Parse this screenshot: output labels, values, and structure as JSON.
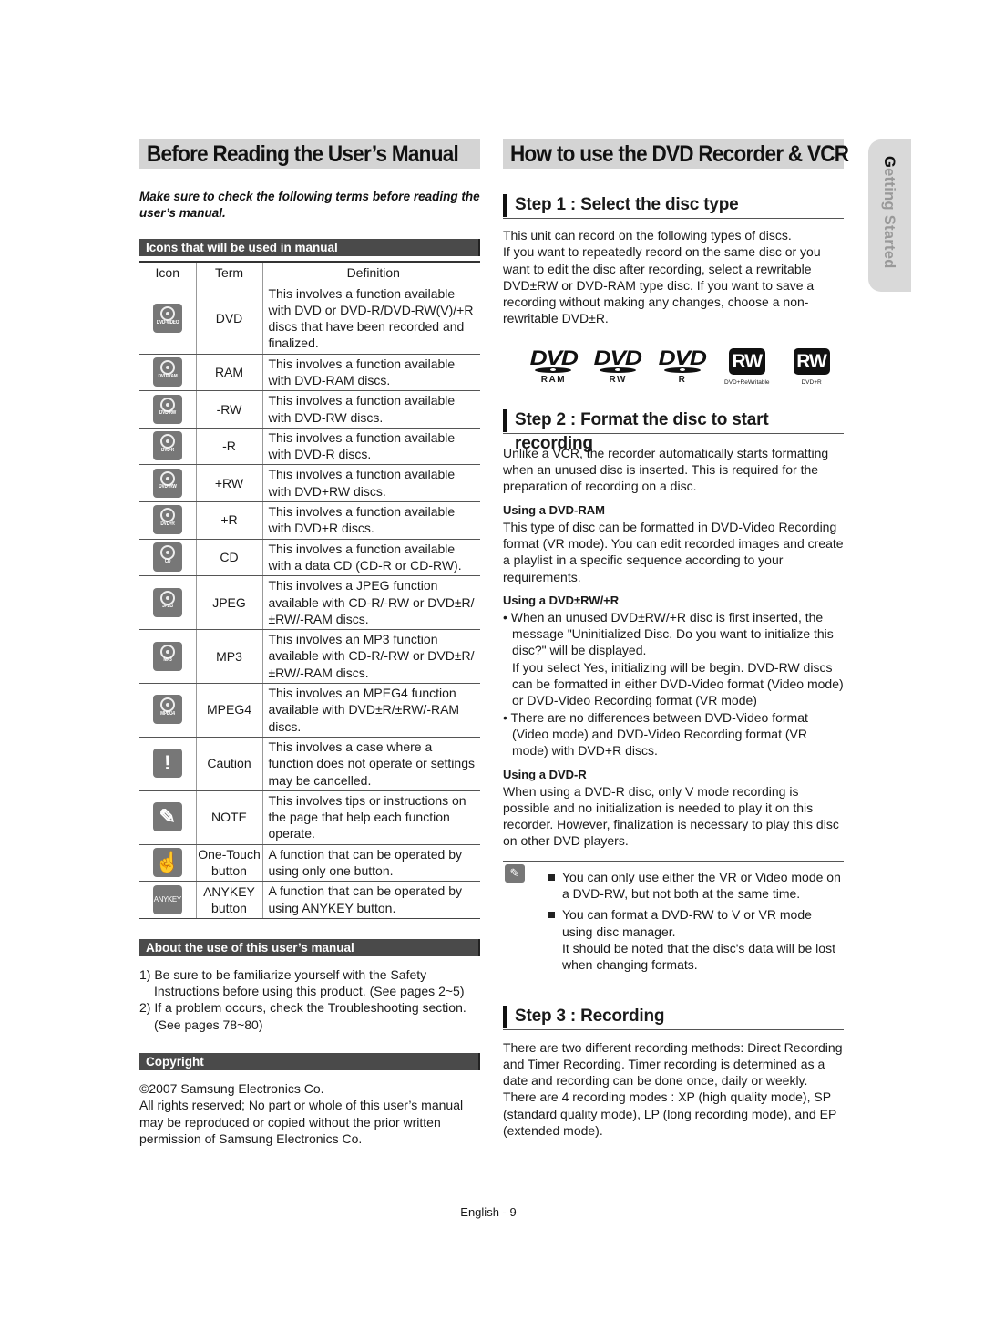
{
  "left": {
    "title": "Before Reading the User’s Manual",
    "intro": "Make sure to check the following terms before reading the user’s manual.",
    "icons_section": {
      "heading": "Icons that will be used in manual",
      "columns": [
        "Icon",
        "Term",
        "Definition"
      ],
      "rows": [
        {
          "icon": "disc-icon",
          "icon_label": "DVD-VIDEO",
          "term": "DVD",
          "definition": "This involves a function available with DVD or DVD-R/DVD-RW(V)/+R discs that have been recorded and finalized."
        },
        {
          "icon": "disc-icon",
          "icon_label": "DVD-RAM",
          "term": "RAM",
          "definition": "This involves a function available with DVD-RAM discs."
        },
        {
          "icon": "disc-icon",
          "icon_label": "DVD-RW",
          "term": "-RW",
          "definition": "This involves a function available with DVD-RW discs."
        },
        {
          "icon": "disc-icon",
          "icon_label": "DVD-R",
          "term": "-R",
          "definition": "This involves a function available with DVD-R discs."
        },
        {
          "icon": "disc-icon",
          "icon_label": "DVD+RW",
          "term": "+RW",
          "definition": "This involves a function available with DVD+RW discs."
        },
        {
          "icon": "disc-icon",
          "icon_label": "DVD+R",
          "term": "+R",
          "definition": "This involves a function available with DVD+R discs."
        },
        {
          "icon": "disc-icon",
          "icon_label": "CD",
          "term": "CD",
          "definition": "This involves a function available with a data CD (CD-R or CD-RW)."
        },
        {
          "icon": "disc-icon",
          "icon_label": "JPEG",
          "term": "JPEG",
          "definition": "This involves a JPEG function available with CD-R/-RW or DVD±R/±RW/-RAM discs."
        },
        {
          "icon": "disc-icon",
          "icon_label": "MP3",
          "term": "MP3",
          "definition": "This involves an MP3 function available with CD-R/-RW or DVD±R/±RW/-RAM discs."
        },
        {
          "icon": "disc-icon",
          "icon_label": "MPEG4",
          "term": "MPEG4",
          "definition": "This involves an MPEG4 function available with DVD±R/±RW/-RAM discs."
        },
        {
          "icon": "caution-icon",
          "icon_label": "!",
          "term": "Caution",
          "definition": "This involves a case where a function does not operate or settings may be cancelled."
        },
        {
          "icon": "note-pencil-icon",
          "icon_label": "✎",
          "term": "NOTE",
          "definition": "This involves tips or instructions on the page that help each function operate."
        },
        {
          "icon": "one-touch-hand-icon",
          "icon_label": "☝",
          "term": "One-Touch button",
          "definition": "A function that can be operated by using only one button."
        },
        {
          "icon": "anykey-icon",
          "icon_label": "ANYKEY",
          "term": "ANYKEY button",
          "definition": "A function that can be operated by using ANYKEY button."
        }
      ]
    },
    "about_section": {
      "heading": "About the use of this user’s manual",
      "items": [
        "1) Be sure to be familiarize yourself with the Safety Instructions before using this product. (See pages 2~5)",
        "2) If a problem occurs, check the Troubleshooting section. (See pages 78~80)"
      ]
    },
    "copyright_section": {
      "heading": "Copyright",
      "line1": "©2007 Samsung Electronics Co.",
      "line2": "All rights reserved; No part or whole of this user’s manual may be reproduced or copied without the prior written permission of Samsung Electronics Co."
    }
  },
  "right": {
    "title": "How to use the DVD Recorder & VCR",
    "step1": {
      "heading": "Step 1 : Select the disc type",
      "text1": "This unit can record on the following types of discs.",
      "text2": "If you want to repeatedly record on the same disc or you want to edit the disc after recording, select a rewritable DVD±RW or DVD-RAM type disc. If you want to save a recording without making any changes, choose a non-rewritable DVD±R.",
      "logos": [
        {
          "type": "dvd",
          "mark": "DVD",
          "label": "RAM"
        },
        {
          "type": "dvd",
          "mark": "DVD",
          "label": "RW"
        },
        {
          "type": "dvd",
          "mark": "DVD",
          "label": "R"
        },
        {
          "type": "rw",
          "mark": "RW",
          "label": "DVD+ReWritable"
        },
        {
          "type": "rw",
          "mark": "RW",
          "label": "DVD+R"
        }
      ]
    },
    "step2": {
      "heading": "Step 2 : Format the disc to start recording",
      "intro": "Unlike a VCR, the recorder automatically starts formatting when an unused disc is inserted. This is required for the preparation of recording on a disc.",
      "ram_heading": "Using a DVD-RAM",
      "ram_text": "This type of disc can be formatted in DVD-Video Recording format (VR mode). You can edit recorded images and create a playlist in a specific sequence according to your requirements.",
      "rw_heading": "Using a DVD±RW/+R",
      "rw_bullet1": "When an unused DVD±RW/+R disc is first inserted, the message \"Uninitialized Disc. Do you want to initialize this disc?\" will be displayed.",
      "rw_bullet1_cont": "If you select Yes, initializing will be begin. DVD-RW discs can be formatted in either DVD-Video format (Video mode) or DVD-Video Recording format (VR mode)",
      "rw_bullet2": "There are no differences between DVD-Video format (Video mode) and DVD-Video Recording format (VR mode) with DVD+R discs.",
      "r_heading": "Using a DVD-R",
      "r_text": "When using a DVD-R disc, only V mode recording is possible and no initialization is needed to play it on this recorder. However, finalization is necessary to play this disc on other DVD players.",
      "notes": [
        "You can only use either the VR or Video mode on a DVD-RW, but not both at the same time.",
        "You can format a DVD-RW to V or VR mode using disc manager."
      ],
      "note2_cont": "It should be noted that the disc's data will be lost when changing formats."
    },
    "step3": {
      "heading": "Step 3 : Recording",
      "text": "There are two different recording methods: Direct Recording and Timer Recording. Timer recording is determined as a date and recording can be done once, daily or weekly. There are 4 recording modes : XP (high quality mode), SP (standard quality mode), LP (long recording mode), and EP (extended mode)."
    }
  },
  "side_tab": {
    "first_letter": "G",
    "rest": "etting Started"
  },
  "footer": {
    "page_label": "English - 9"
  }
}
